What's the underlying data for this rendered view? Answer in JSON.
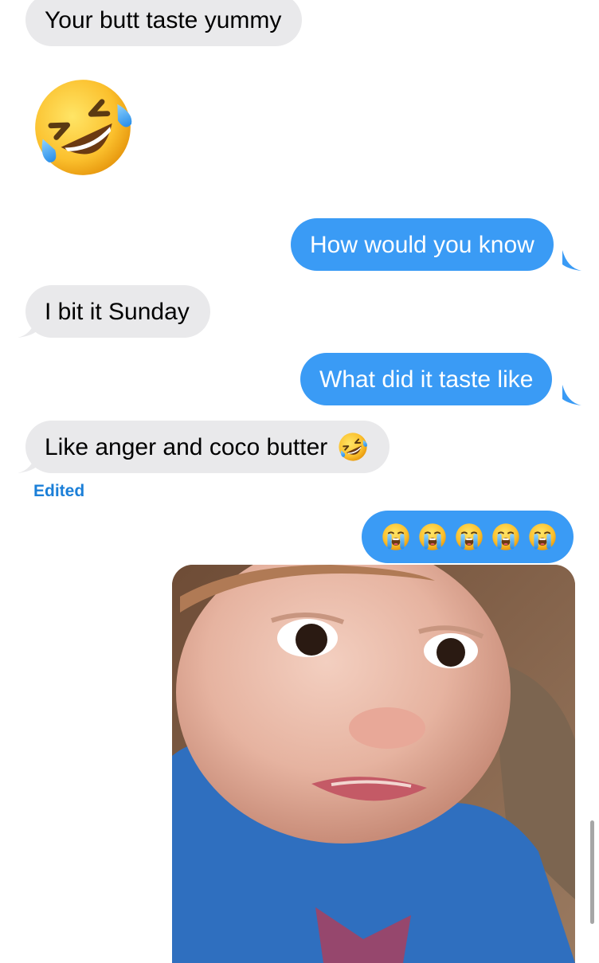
{
  "messages": [
    {
      "id": "m1",
      "direction": "incoming",
      "text": "Your butt taste yummy"
    },
    {
      "id": "m2",
      "direction": "incoming",
      "emoji": "rolling-on-floor-laughing"
    },
    {
      "id": "m3",
      "direction": "outgoing",
      "text": "How would you know"
    },
    {
      "id": "m4",
      "direction": "incoming",
      "text": "I bit it Sunday"
    },
    {
      "id": "m5",
      "direction": "outgoing",
      "text": "What did it taste like"
    },
    {
      "id": "m6",
      "direction": "incoming",
      "text": "Like anger and coco butter",
      "emoji_suffix": "rolling-on-floor-laughing",
      "status": "Edited"
    },
    {
      "id": "m7",
      "direction": "outgoing",
      "emoji_run": [
        "loudly-crying",
        "loudly-crying",
        "loudly-crying",
        "loudly-crying",
        "loudly-crying"
      ]
    },
    {
      "id": "m8",
      "direction": "outgoing",
      "attachment": "photo-crying-child"
    }
  ],
  "colors": {
    "incoming_bubble": "#e9e9eb",
    "outgoing_bubble": "#3a9bf5",
    "edited_label": "#1b7fd8"
  }
}
